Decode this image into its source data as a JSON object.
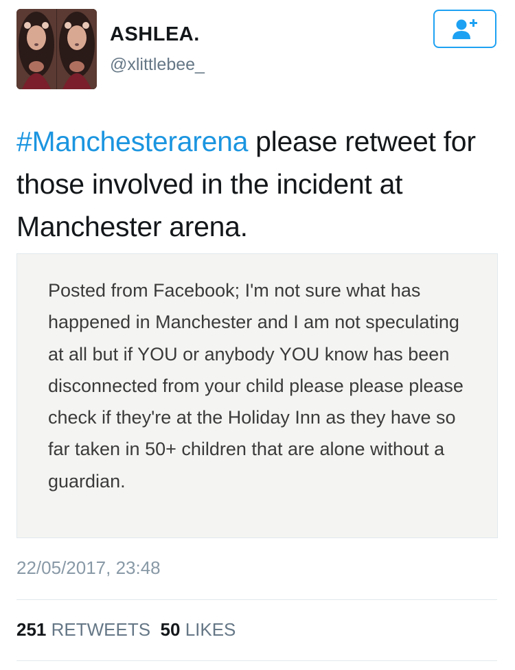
{
  "user": {
    "display_name": "ASHLEA.",
    "handle": "@xlittlebee_"
  },
  "follow_button": {
    "icon": "add-user-icon",
    "color": "#1da1f2"
  },
  "tweet": {
    "hashtag": "#Manchesterarena",
    "text": " please retweet for those involved in the incident at Manchester arena."
  },
  "quoted_image": {
    "text": "Posted from Facebook; I'm not sure what has happened in Manchester and I am not speculating at all but if YOU or anybody YOU know has been disconnected from your child please please please check if they're at the Holiday Inn as they have so far taken in 50+ children that are alone without a guardian."
  },
  "timestamp": "22/05/2017, 23:48",
  "stats": {
    "retweets_count": "251",
    "retweets_label": "RETWEETS",
    "likes_count": "50",
    "likes_label": "LIKES"
  },
  "colors": {
    "link": "#1b95e0",
    "secondary_text": "#657786",
    "border": "#e1e8ed"
  }
}
